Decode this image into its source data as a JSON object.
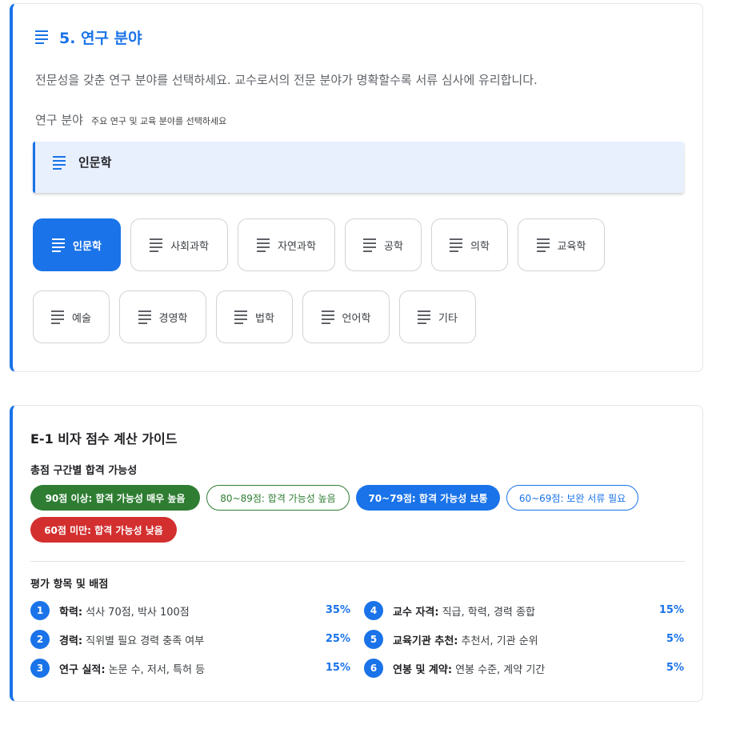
{
  "section5": {
    "title": "5. 연구 분야",
    "description": "전문성을 갖춘 연구 분야를 선택하세요. 교수로서의 전문 분야가 명확할수록 서류 심사에 유리합니다.",
    "field_label": "연구 분야",
    "field_hint": "주요 연구 및 교육 분야를 선택하세요",
    "selected_value": "인문학",
    "fields": [
      {
        "label": "인문학",
        "selected": true
      },
      {
        "label": "사회과학",
        "selected": false
      },
      {
        "label": "자연과학",
        "selected": false
      },
      {
        "label": "공학",
        "selected": false
      },
      {
        "label": "의학",
        "selected": false
      },
      {
        "label": "교육학",
        "selected": false
      },
      {
        "label": "예술",
        "selected": false
      },
      {
        "label": "경영학",
        "selected": false
      },
      {
        "label": "법학",
        "selected": false
      },
      {
        "label": "언어학",
        "selected": false
      },
      {
        "label": "기타",
        "selected": false
      }
    ]
  },
  "guide": {
    "title": "E-1 비자 점수 계산 가이드",
    "ranges_title": "총점 구간별 합격 가능성",
    "ranges": [
      {
        "label": "90점 이상: 합격 가능성 매우 높음",
        "color": "#2e7d32"
      },
      {
        "label": "80~89점: 합격 가능성 높음",
        "color": "#2e7d32"
      },
      {
        "label": "70~79점: 합격 가능성 보통",
        "color": "#1a73e8"
      },
      {
        "label": "60~69점: 보완 서류 필요",
        "color": "#1a73e8"
      },
      {
        "label": "60점 미만: 합격 가능성 낮음",
        "color": "#d32f2f"
      }
    ],
    "items_title": "평가 항목 및 배점",
    "items": [
      {
        "num": "1",
        "name": "학력:",
        "detail": "석사 70점, 박사 100점",
        "weight": "35%"
      },
      {
        "num": "2",
        "name": "경력:",
        "detail": "직위별 필요 경력 충족 여부",
        "weight": "25%"
      },
      {
        "num": "3",
        "name": "연구 실적:",
        "detail": "논문 수, 저서, 특허 등",
        "weight": "15%"
      },
      {
        "num": "4",
        "name": "교수 자격:",
        "detail": "직급, 학력, 경력 종합",
        "weight": "15%"
      },
      {
        "num": "5",
        "name": "교육기관 추천:",
        "detail": "추천서, 기관 순위",
        "weight": "5%"
      },
      {
        "num": "6",
        "name": "연봉 및 계약:",
        "detail": "연봉 수준, 계약 기간",
        "weight": "5%"
      }
    ]
  },
  "colors": {
    "accent": "#1a73e8",
    "green": "#2e7d32",
    "red": "#d32f2f"
  }
}
